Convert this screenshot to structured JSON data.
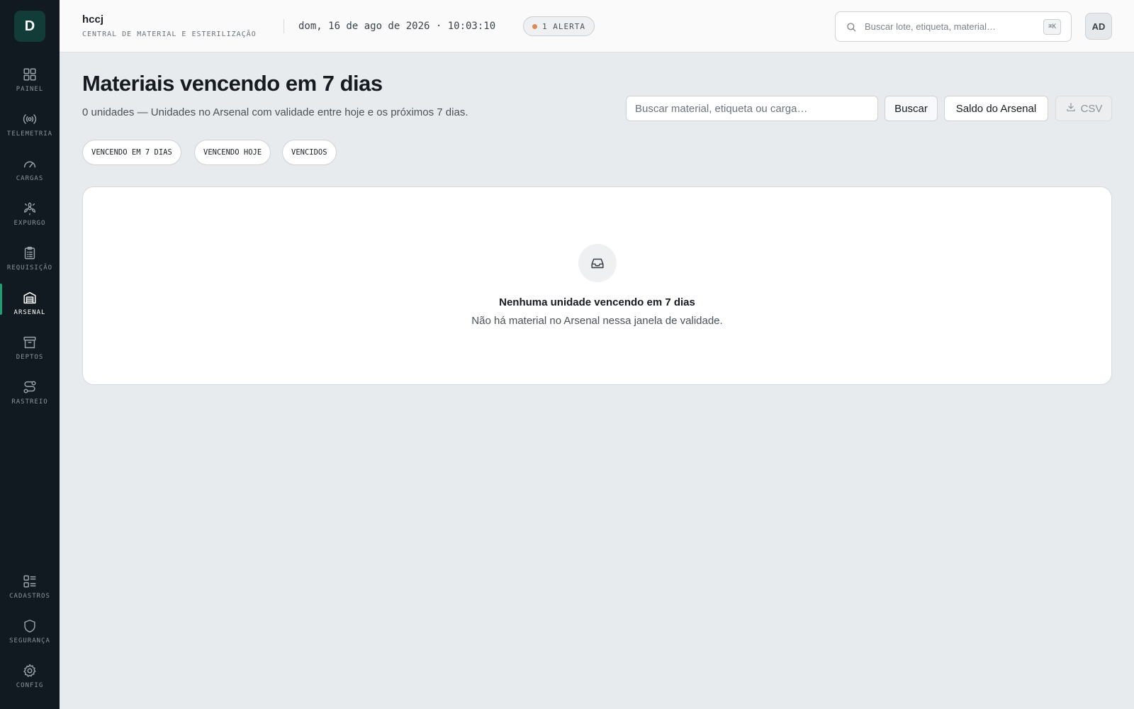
{
  "app": {
    "logo_letter": "D",
    "org_name": "hccj",
    "org_subtitle": "CENTRAL DE MATERIAL E ESTERILIZAÇÃO",
    "datetime": "dom, 16 de ago de 2026 · 10:03:10",
    "alert_label": "1 ALERTA",
    "user_initials": "AD"
  },
  "search": {
    "placeholder": "Buscar lote, etiqueta, material…",
    "shortcut": "⌘K"
  },
  "sidebar": {
    "items": [
      {
        "label": "PAINEL",
        "icon": "dashboard-icon"
      },
      {
        "label": "TELEMETRIA",
        "icon": "broadcast-icon"
      },
      {
        "label": "CARGAS",
        "icon": "gauge-icon"
      },
      {
        "label": "EXPURGO",
        "icon": "biohazard-icon"
      },
      {
        "label": "REQUISIÇÃO",
        "icon": "clipboard-icon"
      },
      {
        "label": "ARSENAL",
        "icon": "warehouse-icon",
        "active": true
      },
      {
        "label": "DEPTOS",
        "icon": "archive-icon"
      },
      {
        "label": "RASTREIO",
        "icon": "route-icon"
      }
    ],
    "bottom_items": [
      {
        "label": "CADASTROS",
        "icon": "list-icon"
      },
      {
        "label": "SEGURANÇA",
        "icon": "shield-icon"
      },
      {
        "label": "CONFIG",
        "icon": "gear-icon"
      }
    ]
  },
  "main": {
    "title": "Materiais vencendo em 7 dias",
    "subtitle": "0 unidades — Unidades no Arsenal com validade entre hoje e os próximos 7 dias.",
    "filter_placeholder": "Buscar material, etiqueta ou carga…",
    "search_button": "Buscar",
    "balance_button": "Saldo do Arsenal",
    "csv_button": "CSV",
    "chips": [
      "VENCENDO EM 7 DIAS",
      "VENCENDO HOJE",
      "VENCIDOS"
    ],
    "empty_title": "Nenhuma unidade vencendo em 7 dias",
    "empty_text": "Não há material no Arsenal nessa janela de validade."
  },
  "colors": {
    "sidebar_bg": "#111a21",
    "accent": "#1f9d74",
    "alert_dot": "#de8a55",
    "page_bg": "#e8ebee"
  }
}
